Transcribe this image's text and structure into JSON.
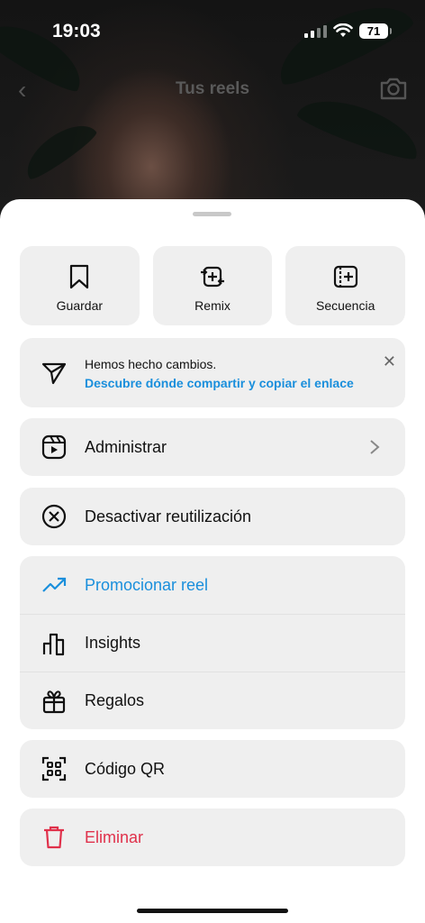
{
  "status": {
    "time": "19:03",
    "battery": "71"
  },
  "header": {
    "title": "Tus reels"
  },
  "tiles": [
    {
      "label": "Guardar",
      "icon": "bookmark-icon"
    },
    {
      "label": "Remix",
      "icon": "remix-icon"
    },
    {
      "label": "Secuencia",
      "icon": "sequence-icon"
    }
  ],
  "notice": {
    "title": "Hemos hecho cambios.",
    "link": "Descubre dónde compartir y copiar el enlace"
  },
  "menu": {
    "manage": "Administrar",
    "disable_reuse": "Desactivar reutilización",
    "promote": "Promocionar reel",
    "insights": "Insights",
    "gifts": "Regalos",
    "qr": "Código QR",
    "delete": "Eliminar"
  },
  "colors": {
    "accent": "#1a8fdc",
    "danger": "#e0314b",
    "tile_bg": "#efefef"
  }
}
